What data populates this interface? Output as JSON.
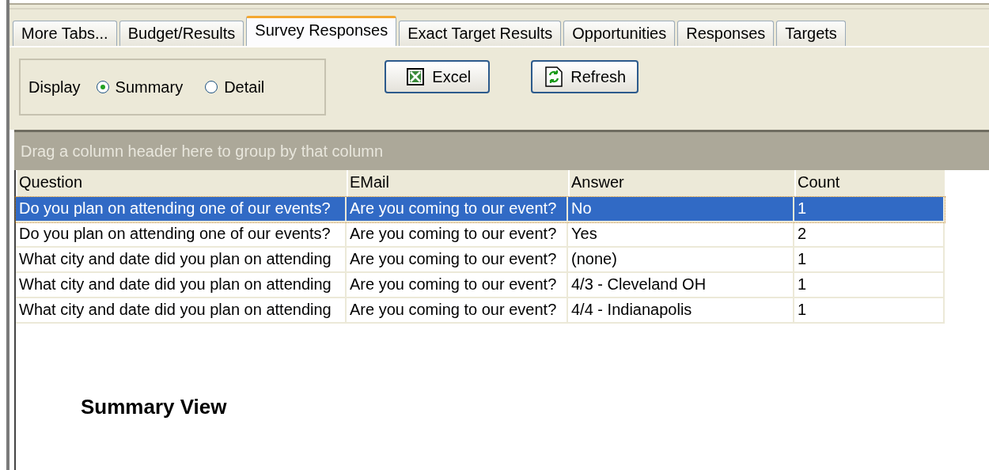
{
  "tabs": [
    {
      "label": "More Tabs...",
      "selected": false
    },
    {
      "label": "Budget/Results",
      "selected": false
    },
    {
      "label": "Survey Responses",
      "selected": true
    },
    {
      "label": "Exact Target Results",
      "selected": false
    },
    {
      "label": "Opportunities",
      "selected": false
    },
    {
      "label": "Responses",
      "selected": false
    },
    {
      "label": "Targets",
      "selected": false
    }
  ],
  "display": {
    "label": "Display",
    "options": [
      {
        "label": "Summary",
        "selected": true
      },
      {
        "label": "Detail",
        "selected": false
      }
    ]
  },
  "buttons": [
    {
      "label": "Excel",
      "kind": "excel"
    },
    {
      "label": "Refresh",
      "kind": "refresh"
    }
  ],
  "group_bar": {
    "text": "Drag a column header here to group by that column"
  },
  "table": {
    "columns": [
      "Question",
      "EMail",
      "Answer",
      "Count"
    ],
    "rows": [
      {
        "cells": [
          "Do you plan on attending one of our events?",
          "Are you coming to our event?",
          "No",
          "1"
        ],
        "selected": true
      },
      {
        "cells": [
          "Do you plan on attending one of our events?",
          "Are you coming to our event?",
          "Yes",
          "2"
        ],
        "selected": false
      },
      {
        "cells": [
          "What city and date did you plan on attending",
          "Are you coming to our event?",
          "(none)",
          "1"
        ],
        "selected": false
      },
      {
        "cells": [
          "What city and date did you plan on attending",
          "Are you coming to our event?",
          "4/3 - Cleveland OH",
          "1"
        ],
        "selected": false
      },
      {
        "cells": [
          "What city and date did you plan on attending",
          "Are you coming to our event?",
          "4/4 - Indianapolis",
          "1"
        ],
        "selected": false
      }
    ]
  },
  "caption": "Summary View"
}
